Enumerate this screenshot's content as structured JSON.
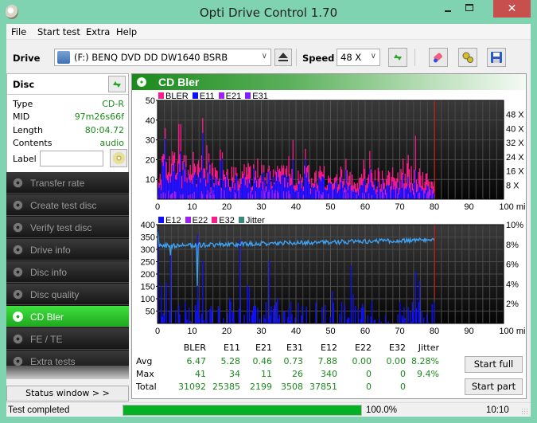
{
  "window": {
    "title": "Opti Drive Control 1.70",
    "minimize_label": "",
    "close_label": "✕"
  },
  "menu": [
    "File",
    "Start test",
    "Extra",
    "Help"
  ],
  "toolbar": {
    "drive_label": "Drive",
    "drive_value": "(F:)   BENQ DVD DD DW1640 BSRB",
    "speed_label": "Speed",
    "speed_value": "48 X",
    "icons": [
      "eject-icon",
      "refresh-icon",
      "erase-icon",
      "settings-icon",
      "save-icon"
    ]
  },
  "disc": {
    "title": "Disc",
    "rows": [
      {
        "key": "Type",
        "value": "CD-R"
      },
      {
        "key": "MID",
        "value": "97m26s66f"
      },
      {
        "key": "Length",
        "value": "80:04.72"
      },
      {
        "key": "Contents",
        "value": "audio"
      }
    ],
    "label_key": "Label",
    "label_value": ""
  },
  "nav": {
    "items": [
      {
        "label": "Transfer rate",
        "active": false
      },
      {
        "label": "Create test disc",
        "active": false
      },
      {
        "label": "Verify test disc",
        "active": false
      },
      {
        "label": "Drive info",
        "active": false
      },
      {
        "label": "Disc info",
        "active": false
      },
      {
        "label": "Disc quality",
        "active": false
      },
      {
        "label": "CD Bler",
        "active": true
      },
      {
        "label": "FE / TE",
        "active": false
      },
      {
        "label": "Extra tests",
        "active": false
      }
    ],
    "status_window_label": "Status window > >"
  },
  "main": {
    "title": "CD Bler",
    "start_full_label": "Start full",
    "start_part_label": "Start part"
  },
  "colors": {
    "accent_green": "#1a8a1a",
    "bler": "#ff1a8c",
    "e11": "#1010ff",
    "e21": "#a020f0",
    "e31": "#8020ff",
    "e12": "#1010ff",
    "e22": "#a020f0",
    "e32": "#ff1a8c",
    "jitter": "#3a8a7a",
    "jitter_line": "#3da0f0",
    "end_marker": "#e01010",
    "progress": "#06b025"
  },
  "chart_data": [
    {
      "type": "bar",
      "title": "BLER / E11 / E21 / E31",
      "legend": [
        "BLER",
        "E11",
        "E21",
        "E31"
      ],
      "xlabel": "min",
      "x_ticks": [
        "0",
        "10",
        "20",
        "30",
        "40",
        "50",
        "60",
        "70",
        "80",
        "90",
        "100 min"
      ],
      "xlim": [
        0,
        100
      ],
      "ylim": [
        0,
        50
      ],
      "y_ticks": [
        "10",
        "20",
        "30",
        "40",
        "50"
      ],
      "y2_ticks": [
        "8 X",
        "16 X",
        "24 X",
        "32 X",
        "40 X",
        "48 X"
      ],
      "y2lim": [
        0,
        56
      ],
      "data_end_min": 80.08,
      "series_summary": {
        "BLER": {
          "typical": [
            8,
            22
          ],
          "peaks": [
            [
              2,
              36
            ],
            [
              6,
              38
            ],
            [
              6.6,
              38
            ],
            [
              13,
              41
            ],
            [
              39,
              30
            ],
            [
              74.5,
              32
            ]
          ]
        },
        "E11": {
          "typical": [
            3,
            16
          ],
          "peaks": [
            [
              2,
              34
            ],
            [
              6,
              33
            ],
            [
              39,
              23
            ]
          ]
        },
        "E21": {
          "typical": [
            0,
            4
          ]
        },
        "E31": {
          "typical": [
            0,
            5
          ]
        }
      }
    },
    {
      "type": "bar",
      "title": "E12 / E22 / E32 / Jitter",
      "legend": [
        "E12",
        "E22",
        "E32",
        "Jitter"
      ],
      "xlabel": "min",
      "x_ticks": [
        "0",
        "10",
        "20",
        "30",
        "40",
        "50",
        "60",
        "70",
        "80",
        "90",
        "100 min"
      ],
      "xlim": [
        0,
        100
      ],
      "ylim": [
        0,
        400
      ],
      "y_ticks": [
        "50",
        "100",
        "150",
        "200",
        "250",
        "300",
        "350",
        "400"
      ],
      "y2_ticks": [
        "2%",
        "4%",
        "6%",
        "8%",
        "10%"
      ],
      "y2lim": [
        0,
        10
      ],
      "data_end_min": 80.08,
      "series_summary": {
        "E12": {
          "typical": [
            0,
            120
          ],
          "peaks": [
            [
              0.1,
              380
            ],
            [
              3.7,
              280
            ],
            [
              11.5,
              360
            ],
            [
              13,
              255
            ],
            [
              23.8,
              340
            ],
            [
              32,
              255
            ],
            [
              55.7,
              235
            ],
            [
              74.5,
              210
            ]
          ]
        },
        "Jitter_percent": {
          "start": 9.4,
          "typical": [
            7.6,
            8.6
          ],
          "end": 8.5
        }
      }
    }
  ],
  "stats": {
    "columns": [
      "BLER",
      "E11",
      "E21",
      "E31",
      "E12",
      "E22",
      "E32",
      "Jitter"
    ],
    "rows": [
      {
        "label": "Avg",
        "values": [
          "6.47",
          "5.28",
          "0.46",
          "0.73",
          "7.88",
          "0.00",
          "0.00",
          "8.28%"
        ]
      },
      {
        "label": "Max",
        "values": [
          "41",
          "34",
          "11",
          "26",
          "340",
          "0",
          "0",
          "9.4%"
        ]
      },
      {
        "label": "Total",
        "values": [
          "31092",
          "25385",
          "2199",
          "3508",
          "37851",
          "0",
          "0",
          ""
        ]
      }
    ]
  },
  "statusbar": {
    "text": "Test completed",
    "progress_percent": 100.0,
    "progress_label": "100.0%",
    "time": "10:10"
  }
}
